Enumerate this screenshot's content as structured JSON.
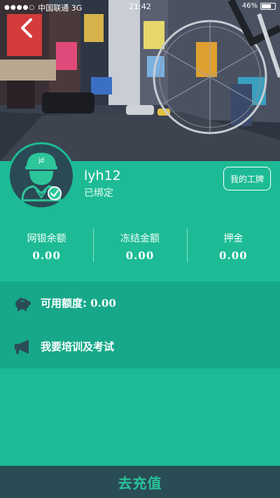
{
  "status_bar": {
    "carrier": "中国联通 3G",
    "time": "21:42",
    "battery": "46%"
  },
  "profile": {
    "username": "lyh12",
    "bind_status": "已绑定",
    "badge_button_label": "我的工牌",
    "avatar_tag": "jd"
  },
  "stats": [
    {
      "label": "网银余额",
      "value": "0.00"
    },
    {
      "label": "冻结金额",
      "value": "0.00"
    },
    {
      "label": "押金",
      "value": "0.00"
    }
  ],
  "menu": {
    "available_label": "可用额度:",
    "available_value": "0.00",
    "training_label": "我要培训及考试"
  },
  "recharge_label": "去充值",
  "colors": {
    "primary": "#1dbb95",
    "list_background": "#16a889",
    "bottom_bar": "#2a4d55",
    "bottom_text": "#27c29a"
  },
  "icons": {
    "back": "back-arrow-icon",
    "piggy": "piggy-bank-icon",
    "megaphone": "megaphone-icon",
    "check": "check-icon"
  }
}
